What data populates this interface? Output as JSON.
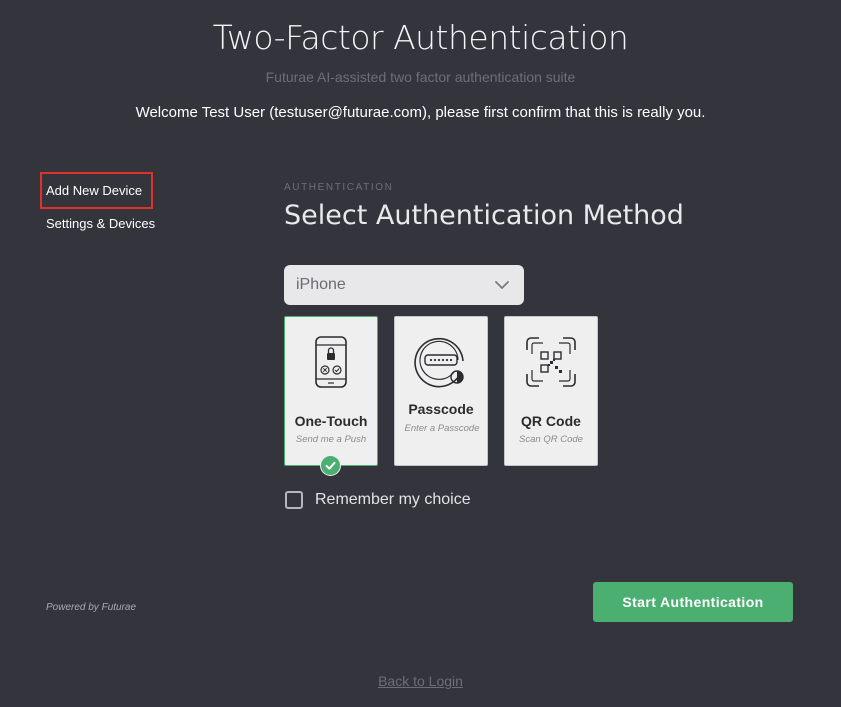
{
  "header": {
    "title": "Two-Factor Authentication",
    "subtitle": "Futurae AI-assisted two factor authentication suite",
    "welcome": "Welcome Test User (testuser@futurae.com), please first confirm that this is really you."
  },
  "sidebar": {
    "items": [
      {
        "label": "Add New Device",
        "highlighted": true
      },
      {
        "label": "Settings & Devices",
        "highlighted": false
      }
    ],
    "powered_by": "Powered by Futurae"
  },
  "main": {
    "section_label": "AUTHENTICATION",
    "section_title": "Select Authentication Method",
    "device_select": {
      "value": "iPhone"
    },
    "methods": [
      {
        "name": "One-Touch",
        "description": "Send me a Push",
        "icon": "phone-push-icon",
        "selected": true
      },
      {
        "name": "Passcode",
        "description": "Enter a Passcode",
        "icon": "passcode-icon",
        "selected": false
      },
      {
        "name": "QR Code",
        "description": "Scan QR Code",
        "icon": "qr-code-icon",
        "selected": false
      }
    ],
    "remember_label": "Remember my choice",
    "remember_checked": false,
    "start_button": "Start Authentication"
  },
  "footer": {
    "back_link": "Back to Login"
  },
  "colors": {
    "background": "#33343c",
    "accent": "#4caf72",
    "highlight_border": "#e0312a"
  }
}
